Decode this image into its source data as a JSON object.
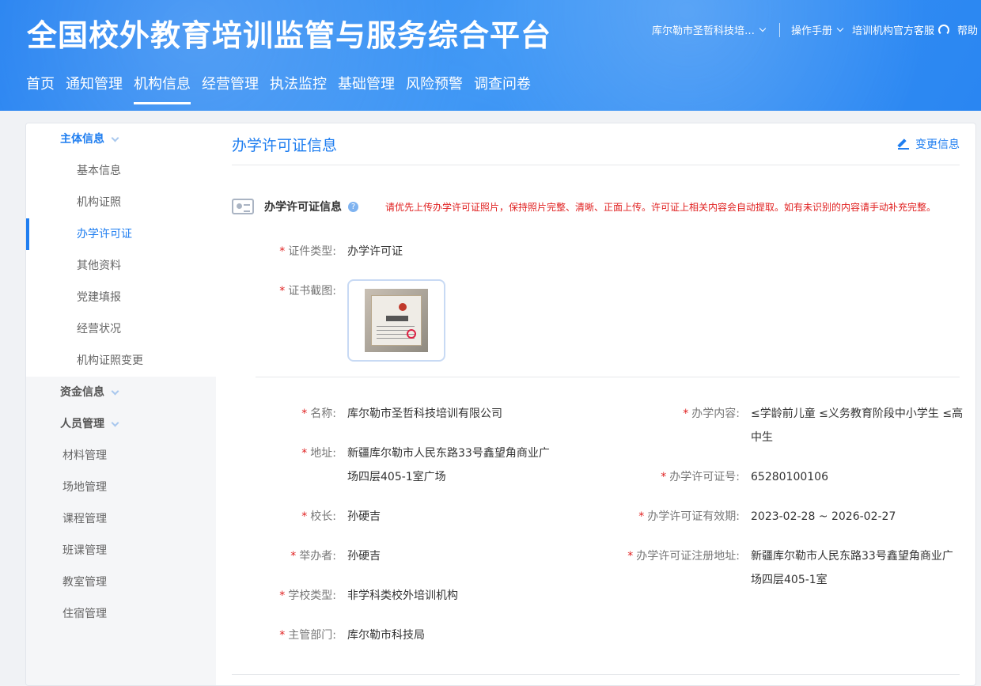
{
  "header": {
    "title": "全国校外教育培训监管与服务综合平台",
    "org_selector": "库尔勒市圣哲科技培…",
    "manual": "操作手册",
    "service": "培训机构官方客服",
    "help": "帮助"
  },
  "nav": [
    {
      "label": "首页"
    },
    {
      "label": "通知管理"
    },
    {
      "label": "机构信息"
    },
    {
      "label": "经营管理"
    },
    {
      "label": "执法监控"
    },
    {
      "label": "基础管理"
    },
    {
      "label": "风险预警"
    },
    {
      "label": "调查问卷"
    }
  ],
  "sidebar": {
    "group_main": "主体信息",
    "sub_items": [
      {
        "label": "基本信息"
      },
      {
        "label": "机构证照"
      },
      {
        "label": "办学许可证"
      },
      {
        "label": "其他资料"
      },
      {
        "label": "党建填报"
      },
      {
        "label": "经营状况"
      },
      {
        "label": "机构证照变更"
      }
    ],
    "group_funds": "资金信息",
    "group_staff": "人员管理",
    "plain_items": [
      {
        "label": "材料管理"
      },
      {
        "label": "场地管理"
      },
      {
        "label": "课程管理"
      },
      {
        "label": "班课管理"
      },
      {
        "label": "教室管理"
      },
      {
        "label": "住宿管理"
      }
    ]
  },
  "content": {
    "title": "办学许可证信息",
    "edit_label": "变更信息",
    "section_title": "办学许可证信息",
    "section_note": "请优先上传办学许可证照片，保持照片完整、清晰、正面上传。许可证上相关内容会自动提取。如有未识别的内容请手动补充完整。",
    "cert_type_label": "证件类型:",
    "cert_type_value": "办学许可证",
    "cert_image_label": "证书截图:",
    "fields_left": {
      "name_label": "名称:",
      "name_value": "库尔勒市圣哲科技培训有限公司",
      "address_label": "地址:",
      "address_value_1": "新疆库尔勒市人民东路33号鑫望角商业广",
      "address_value_2": "场四层405-1室广场",
      "principal_label": "校长:",
      "principal_value": "孙硬吉",
      "sponsor_label": "举办者:",
      "sponsor_value": "孙硬吉",
      "school_type_label": "学校类型:",
      "school_type_value": "非学科类校外培训机构",
      "dept_label": "主管部门:",
      "dept_value": "库尔勒市科技局"
    },
    "fields_right": {
      "content_label": "办学内容:",
      "content_value_1": "≤学龄前儿童 ≤义务教育阶段中小学生 ≤高",
      "content_value_2": "中生",
      "license_no_label": "办学许可证号:",
      "license_no_value": "65280100106",
      "validity_label": "办学许可证有效期:",
      "validity_value": "2023-02-28 ~ 2026-02-27",
      "reg_address_label": "办学许可证注册地址:",
      "reg_address_value_1": "新疆库尔勒市人民东路33号鑫望角商业广",
      "reg_address_value_2": "场四层405-1室"
    }
  },
  "colors": {
    "brand_blue": "#1f7ef0",
    "required_red": "#e02020"
  }
}
